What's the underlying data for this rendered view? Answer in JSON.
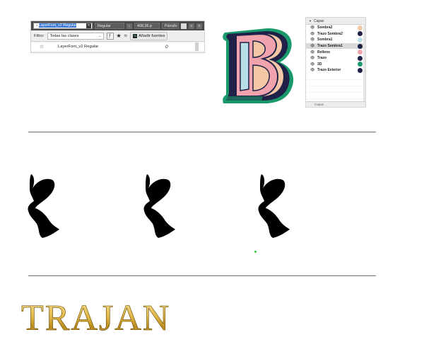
{
  "font_panel": {
    "search_value": "LayerFont_v2 Regular",
    "style_value": "Regular",
    "size_value": "408,36 p",
    "paragraph_value": "Párrafo",
    "filter_label": "Filtro:",
    "filter_value": "Todas las clases",
    "add_fonts_label": "Añadir fuentes",
    "font_row": {
      "name": "LayerFont_v2 Regular",
      "sample": "0"
    }
  },
  "layers_panel": {
    "title": "Capas",
    "footer": "Capas",
    "layers": [
      {
        "name": "Sombra2",
        "color": "#f3c7a5"
      },
      {
        "name": "Trazo Sombra2",
        "color": "#1f2148"
      },
      {
        "name": "Sombra1",
        "color": "#b9dfe7"
      },
      {
        "name": "Trazo Sombra1",
        "color": "#1f2148",
        "selected": true
      },
      {
        "name": "Relleno",
        "color": "#f1a3ad"
      },
      {
        "name": "Trazo",
        "color": "#1f2148"
      },
      {
        "name": "3D",
        "color": "#1a9a6b"
      },
      {
        "name": "Trazo Exterior",
        "color": "#1f2148"
      }
    ]
  },
  "colors": {
    "green": "#1a9a6b",
    "navy": "#1f2148",
    "pink": "#f1a3ad",
    "light_blue": "#b9dfe7",
    "peach": "#f3c7a5",
    "gold": "#d4a93a"
  },
  "trajan_text": "TRAJAN"
}
